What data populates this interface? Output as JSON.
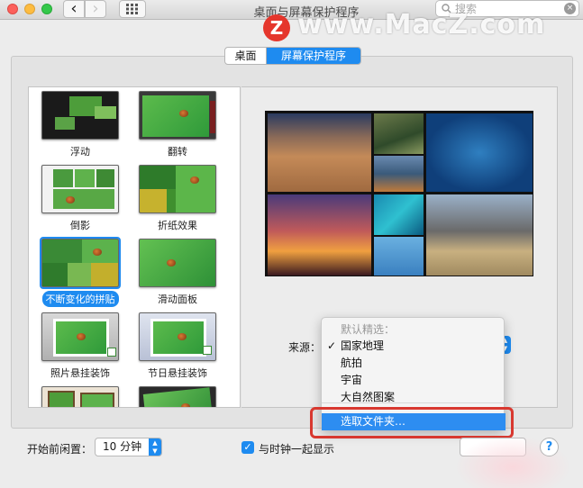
{
  "window": {
    "title": "桌面与屏幕保护程序",
    "search_placeholder": "搜索",
    "back_glyph": "‹",
    "forward_glyph": "›"
  },
  "watermark": {
    "logo_letter": "Z",
    "text": "www.MacZ.com"
  },
  "tabs": [
    {
      "label": "桌面",
      "selected": false
    },
    {
      "label": "屏幕保护程序",
      "selected": true
    }
  ],
  "savers": [
    {
      "label": "浮动",
      "selected": false
    },
    {
      "label": "翻转",
      "selected": false
    },
    {
      "label": "倒影",
      "selected": false
    },
    {
      "label": "折纸效果",
      "selected": false
    },
    {
      "label": "不断变化的拼贴",
      "selected": true
    },
    {
      "label": "滑动面板",
      "selected": false
    },
    {
      "label": "照片悬挂装饰",
      "selected": false
    },
    {
      "label": "节日悬挂装饰",
      "selected": false
    }
  ],
  "source": {
    "label": "来源："
  },
  "source_menu": {
    "header": "默认精选：",
    "items": [
      {
        "label": "国家地理",
        "checked": true
      },
      {
        "label": "航拍",
        "checked": false
      },
      {
        "label": "宇宙",
        "checked": false
      },
      {
        "label": "大自然图案",
        "checked": false
      }
    ],
    "choose_folder": "选取文件夹…"
  },
  "bottom": {
    "idle_label": "开始前闲置：",
    "idle_value": "10 分钟",
    "show_clock_label": "与时钟一起显示",
    "show_clock_checked": true,
    "help": "?"
  },
  "colors": {
    "accent": "#1e8bf0",
    "highlight_frame": "#d8382f"
  }
}
